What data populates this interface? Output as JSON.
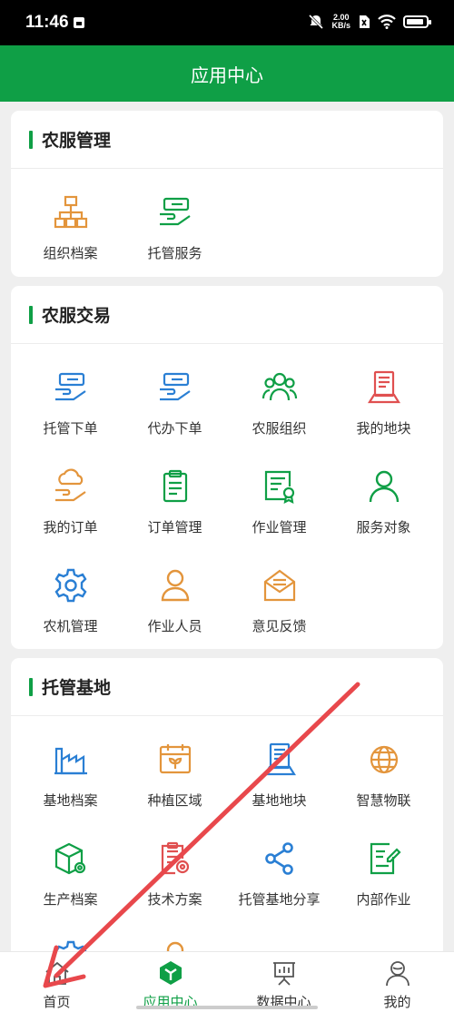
{
  "status_bar": {
    "time": "11:46",
    "speed_value": "2.00",
    "speed_unit": "KB/s"
  },
  "header": {
    "title": "应用中心"
  },
  "colors": {
    "brand_green": "#0f9f46",
    "icon_blue": "#2a7fd4",
    "icon_orange": "#e3953c",
    "icon_red": "#e05050",
    "arrow_red": "#e8484c"
  },
  "sections": [
    {
      "title": "农服管理",
      "items": [
        {
          "label": "组织档案",
          "icon": "org-chart-icon"
        },
        {
          "label": "托管服务",
          "icon": "hand-card-icon"
        }
      ]
    },
    {
      "title": "农服交易",
      "items": [
        {
          "label": "托管下单",
          "icon": "hand-card-icon"
        },
        {
          "label": "代办下单",
          "icon": "hand-card-icon"
        },
        {
          "label": "农服组织",
          "icon": "group-icon"
        },
        {
          "label": "我的地块",
          "icon": "land-plot-icon"
        },
        {
          "label": "我的订单",
          "icon": "cloud-hand-icon"
        },
        {
          "label": "订单管理",
          "icon": "clipboard-icon"
        },
        {
          "label": "作业管理",
          "icon": "certificate-icon"
        },
        {
          "label": "服务对象",
          "icon": "user-icon"
        },
        {
          "label": "农机管理",
          "icon": "gear-icon"
        },
        {
          "label": "作业人员",
          "icon": "person-icon"
        },
        {
          "label": "意见反馈",
          "icon": "envelope-icon"
        }
      ]
    },
    {
      "title": "托管基地",
      "items": [
        {
          "label": "基地档案",
          "icon": "factory-icon"
        },
        {
          "label": "种植区域",
          "icon": "calendar-plant-icon"
        },
        {
          "label": "基地地块",
          "icon": "land-plot-icon"
        },
        {
          "label": "智慧物联",
          "icon": "globe-icon"
        },
        {
          "label": "生产档案",
          "icon": "box-gear-icon"
        },
        {
          "label": "技术方案",
          "icon": "document-gear-icon"
        },
        {
          "label": "托管基地分享",
          "icon": "share-icon"
        },
        {
          "label": "内部作业",
          "icon": "edit-doc-icon"
        }
      ]
    }
  ],
  "tabbar": [
    {
      "label": "首页",
      "icon": "home-icon",
      "active": false
    },
    {
      "label": "应用中心",
      "icon": "app-center-icon",
      "active": true
    },
    {
      "label": "数据中心",
      "icon": "data-board-icon",
      "active": false
    },
    {
      "label": "我的",
      "icon": "profile-icon",
      "active": false
    }
  ]
}
